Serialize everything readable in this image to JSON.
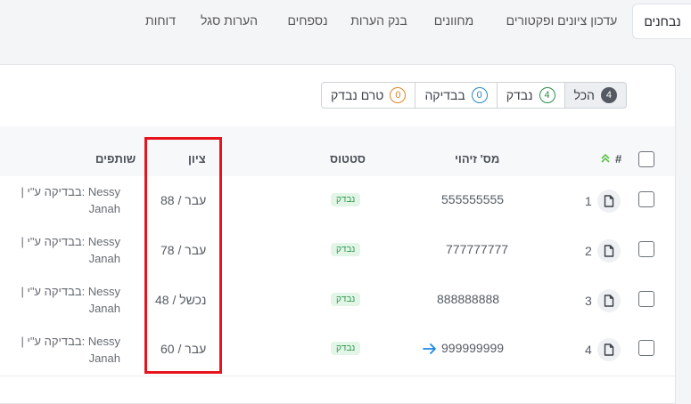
{
  "tabs": [
    {
      "label": "נבחנים",
      "active": true
    },
    {
      "label": "עדכון ציונים ופקטורים",
      "active": false
    },
    {
      "label": "מחוונים",
      "active": false
    },
    {
      "label": "בנק הערות",
      "active": false
    },
    {
      "label": "נספחים",
      "active": false
    },
    {
      "label": "הערות סגל",
      "active": false
    },
    {
      "label": "דוחות",
      "active": false
    }
  ],
  "filters": [
    {
      "label": "הכל",
      "count": "4"
    },
    {
      "label": "נבדק",
      "count": "4"
    },
    {
      "label": "בבדיקה",
      "count": "0"
    },
    {
      "label": "טרם נבדק",
      "count": "0"
    }
  ],
  "table": {
    "headers": {
      "num": "#",
      "id": "מס' זיהוי",
      "status": "סטטוס",
      "grade": "ציון",
      "partners": "שותפים"
    },
    "rows": [
      {
        "num": "1",
        "id": "555555555",
        "status": "נבדק",
        "grade": "88 / עבר",
        "partners_line1": "| בבדיקה ע\"י: Nessy",
        "partners_line2": "Janah"
      },
      {
        "num": "2",
        "id": "777777777",
        "status": "נבדק",
        "grade": "78 / עבר",
        "partners_line1": "| בבדיקה ע\"י: Nessy",
        "partners_line2": "Janah"
      },
      {
        "num": "3",
        "id": "888888888",
        "status": "נבדק",
        "grade": "48 / נכשל",
        "partners_line1": "| בבדיקה ע\"י: Nessy",
        "partners_line2": "Janah"
      },
      {
        "num": "4",
        "id": "999999999",
        "status": "נבדק",
        "grade": "60 / עבר",
        "partners_line1": "| בבדיקה ע\"י: Nessy",
        "partners_line2": "Janah"
      }
    ]
  },
  "icons": {
    "sort": "sort-up-chevrons-icon",
    "doc": "document-icon",
    "arrow": "arrow-right-icon"
  },
  "colors": {
    "highlight": "#e8141c",
    "status_bg": "#e2f5e7",
    "status_fg": "#2e9a50",
    "link": "#1e88e5"
  }
}
